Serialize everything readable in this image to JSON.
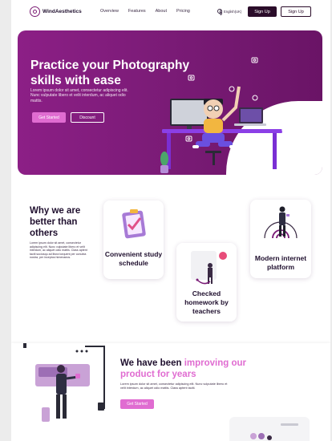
{
  "brand": {
    "name": "WindAesthetics"
  },
  "nav": {
    "links": [
      "Overview",
      "Features",
      "About",
      "Pricing"
    ],
    "language": "English(UK)",
    "signup_primary": "Sign Up",
    "signup_secondary": "Sign Up"
  },
  "hero": {
    "title": "Practice your Photography skills with ease",
    "text": "Lorem ipsum dolor sit amet, consectetur adipiscing elit. Nunc vulputate libero et velit interdum, ac aliquet odio mattis.",
    "cta_primary": "Get Started",
    "cta_secondary": "Discount"
  },
  "why": {
    "title": "Why we are better than others",
    "text": "Lorem ipsum dolor sit amet, consectetur adipiscing elit. Nunc vulputate libero et velit interdum, ac aliquet odio mattis. Class aptent taciti sociosqu ad litora torquent per conubia nostra, per inceptos himenaeos."
  },
  "features": [
    {
      "label": "Convenient study schedule"
    },
    {
      "label": "Checked homework by teachers"
    },
    {
      "label": "Modern internet platform"
    }
  ],
  "improve": {
    "title_prefix": "We have been",
    "title_highlight": "improving our product for years",
    "text": "Lorem ipsum dolor sit amet, consectetur adipiscing elit. Nunc vulputate libero et velit interdum, ac aliquet odio mattis. Class aptent taciti.",
    "cta": "Get Started"
  },
  "colors": {
    "accent": "#e06cd1",
    "brand": "#7a1b76",
    "dark": "#2b0d2a"
  }
}
